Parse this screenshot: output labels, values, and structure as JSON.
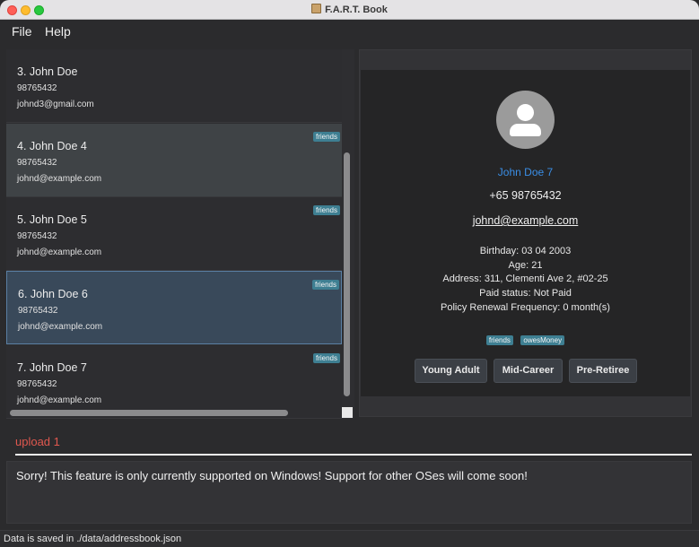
{
  "window": {
    "title": "F.A.R.T. Book"
  },
  "menu": {
    "file": "File",
    "help": "Help"
  },
  "list": {
    "cards": [
      {
        "name": "3.  John Doe",
        "phone": "98765432",
        "email": "johnd3@gmail.com",
        "tag": ""
      },
      {
        "name": "4.  John Doe 4",
        "phone": "98765432",
        "email": "johnd@example.com",
        "tag": "friends"
      },
      {
        "name": "5.  John Doe  5",
        "phone": "98765432",
        "email": "johnd@example.com",
        "tag": "friends"
      },
      {
        "name": "6.  John Doe 6",
        "phone": "98765432",
        "email": "johnd@example.com",
        "tag": "friends"
      },
      {
        "name": "7.  John Doe 7",
        "phone": "98765432",
        "email": "johnd@example.com",
        "tag": "friends"
      }
    ]
  },
  "detail": {
    "name": "John Doe 7",
    "phone": "+65 98765432",
    "email": "johnd@example.com",
    "birthday": "Birthday: 03 04 2003",
    "age": "Age: 21",
    "address": "Address: 311, Clementi Ave 2, #02-25",
    "paid_status": "Paid status: Not Paid",
    "renewal": "Policy Renewal Frequency: 0 month(s)",
    "tags": [
      "friends",
      "owesMoney"
    ],
    "buttons": [
      "Young Adult",
      "Mid-Career",
      "Pre-Retiree"
    ]
  },
  "command": {
    "text": "upload 1"
  },
  "result": {
    "text": "Sorry! This feature is only currently supported on Windows! Support for other OSes will come soon!"
  },
  "status": {
    "text": "Data is saved in ./data/addressbook.json"
  },
  "colors": {
    "accent": "#3a8ee6",
    "error": "#e0584f",
    "tag": "#3e7f92",
    "selected": "#39495a"
  }
}
